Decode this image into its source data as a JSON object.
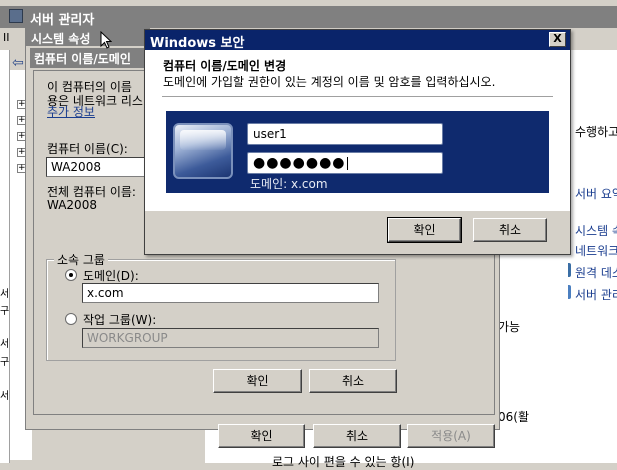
{
  "server_manager": {
    "title": "서버 관리자",
    "menu_first_letter": "II",
    "right_panel": {
      "action_text": "수행하고",
      "link_server_summary": "서버 요약",
      "link_system": "시스템 속",
      "link_network": "네트워크",
      "link_remote": "원격 데스",
      "link_server_manage": "서버 관리"
    },
    "content": {
      "text_possible": "가능",
      "text_2006": "06(활",
      "text_bottom": "로그 사이 편을 수 있는 항(I)"
    },
    "left_strip_chars": [
      "서",
      "구",
      "서",
      "구",
      "서"
    ]
  },
  "system_properties": {
    "title": "시스템 속성"
  },
  "computer_name_dialog": {
    "title": "컴퓨터 이름/도메인",
    "description_line1": "이 컴퓨터의 이름",
    "description_line2": "용은 네트워크 리스",
    "more_info_link": "추가 정보",
    "computer_name_label": "컴퓨터 이름(C):",
    "computer_name_value": "WA2008",
    "full_name_label": "전체 컴퓨터 이름:",
    "full_name_value": "WA2008",
    "member_of_label": "소속 그룹",
    "domain_radio_label": "도메인(D):",
    "domain_value": "x.com",
    "workgroup_radio_label": "작업 그룹(W):",
    "workgroup_value": "WORKGROUP",
    "ok_label": "확인",
    "cancel_label": "취소"
  },
  "sysprops_footer": {
    "ok_label": "확인",
    "cancel_label": "취소",
    "apply_label": "적용(A)"
  },
  "windows_security": {
    "title": "Windows 보안",
    "close_glyph": "X",
    "heading": "컴퓨터 이름/도메인 변경",
    "description": "도메인에 가입할 권한이 있는 계정의 이름 및 암호를 입력하십시오.",
    "username_value": "user1",
    "password_value": "●●●●●●●",
    "domain_text": "도메인: x.com",
    "ok_label": "확인",
    "cancel_label": "취소"
  }
}
